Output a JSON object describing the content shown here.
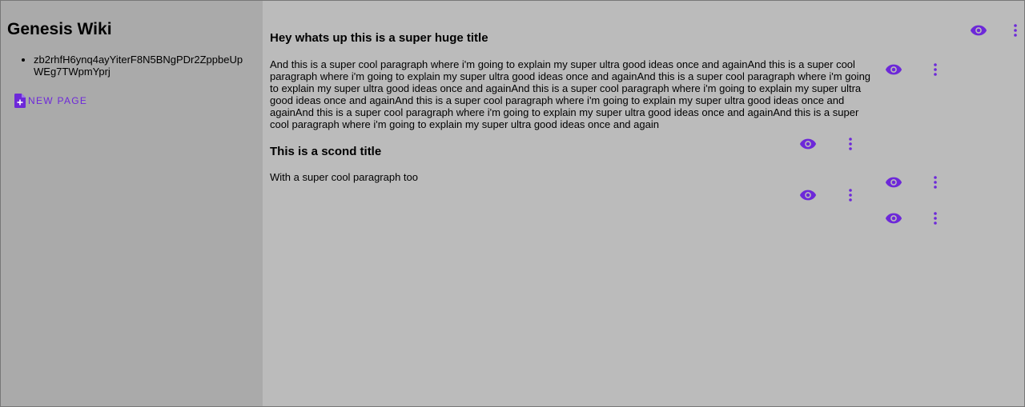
{
  "sidebar": {
    "title": "Genesis Wiki",
    "pages": [
      "zb2rhfH6ynq4ayYiterF8N5BNgPDr2ZppbeUpWEg7TWpmYprj"
    ],
    "new_page_label": "NEW PAGE",
    "new_page_icon": "note-add-icon"
  },
  "content": {
    "title1": "Hey whats up this is a super huge title",
    "paragraph1": "And this is a super cool paragraph where i'm going to explain my super ultra good ideas once and againAnd this is a super cool paragraph where i'm going to explain my super ultra good ideas once and againAnd this is a super cool paragraph where i'm going to explain my super ultra good ideas once and againAnd this is a super cool paragraph where i'm going to explain my super ultra good ideas once and againAnd this is a super cool paragraph where i'm going to explain my super ultra good ideas once and againAnd this is a super cool paragraph where i'm going to explain my super ultra good ideas once and againAnd this is a super cool paragraph where i'm going to explain my super ultra good ideas once and again",
    "title2": "This is a scond title",
    "paragraph2": "With a super cool paragraph too"
  },
  "icons": {
    "view": "eye-icon",
    "menu": "more-vert-icon"
  },
  "colors": {
    "accent": "#6d28d9",
    "sidebar_bg": "#aaaaaa",
    "main_bg": "#bbbbbb"
  }
}
